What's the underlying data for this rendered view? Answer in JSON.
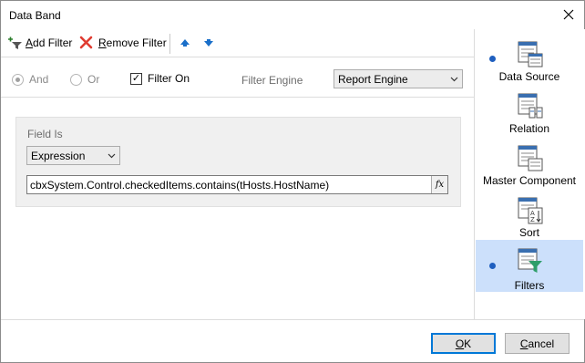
{
  "window": {
    "title": "Data Band"
  },
  "toolbar": {
    "add_filter_key": "A",
    "add_filter_rest": "dd Filter",
    "remove_filter_key": "R",
    "remove_filter_rest": "emove Filter"
  },
  "options": {
    "and_label": "And",
    "or_label": "Or",
    "filter_on_label": "Filter On",
    "filter_on_checked": true,
    "filter_engine_label": "Filter Engine",
    "filter_engine_value": "Report Engine"
  },
  "filter": {
    "field_is_label": "Field Is",
    "field_type_value": "Expression",
    "expression_value": "cbxSystem.Control.checkedItems.contains(tHosts.HostName)",
    "fx_label": "fx"
  },
  "sidebar": {
    "items": [
      {
        "label": "Data Source",
        "has_dot": true,
        "selected": false
      },
      {
        "label": "Relation",
        "has_dot": false,
        "selected": false
      },
      {
        "label": "Master Component",
        "has_dot": false,
        "selected": false
      },
      {
        "label": "Sort",
        "has_dot": false,
        "selected": false
      },
      {
        "label": "Filters",
        "has_dot": true,
        "selected": true
      }
    ]
  },
  "buttons": {
    "ok_key": "O",
    "ok_rest": "K",
    "cancel_key": "C",
    "cancel_rest": "ancel"
  },
  "colors": {
    "accent": "#0078d7",
    "selected_bg": "#cce0fb",
    "dot": "#1f5fbf",
    "remove_red": "#e03c31",
    "arrow_blue": "#1a6fc9"
  }
}
